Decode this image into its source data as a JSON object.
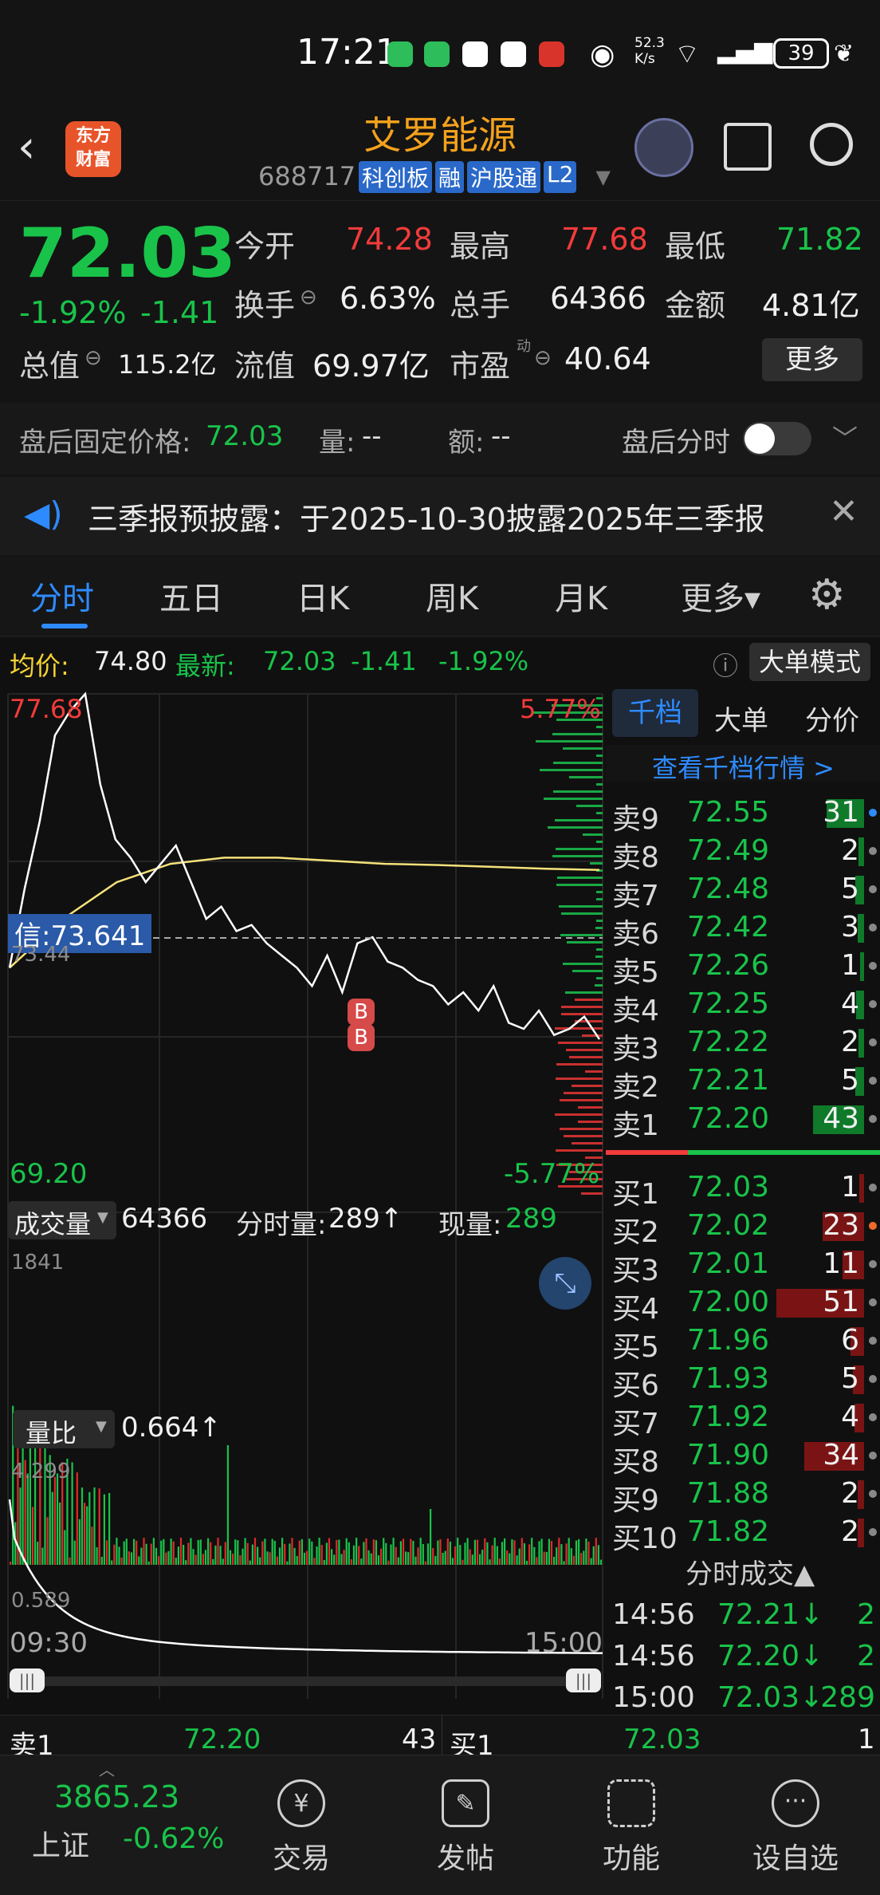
{
  "status_bar": {
    "time": "17:21",
    "net_speed": "52.3\nK/s",
    "battery": "39"
  },
  "header": {
    "logo_line1": "东方",
    "logo_line2": "财富",
    "title": "艾罗能源",
    "code": "688717",
    "tags": [
      "科创板",
      "融",
      "沪股通",
      "L2"
    ]
  },
  "quote": {
    "price": "72.03",
    "change_pct": "-1.92%",
    "change": "-1.41",
    "open_label": "今开",
    "open": "74.28",
    "high_label": "最高",
    "high": "77.68",
    "low_label": "最低",
    "low": "71.82",
    "turnover_label": "换手",
    "turnover": "6.63%",
    "volume_label": "总手",
    "volume": "64366",
    "amount_label": "金额",
    "amount": "4.81亿",
    "mcap_label": "总值",
    "mcap": "115.2亿",
    "float_label": "流值",
    "float": "69.97亿",
    "pe_label": "市盈",
    "pe_sup": "动",
    "pe": "40.64",
    "more_button": "更多"
  },
  "after_hours": {
    "price_label": "盘后固定价格:",
    "price": "72.03",
    "vol_label": "量:",
    "vol": "--",
    "amt_label": "额:",
    "amt": "--",
    "toggle_label": "盘后分时"
  },
  "notice": {
    "text": "三季报预披露：于2025-10-30披露2025年三季报"
  },
  "tabs": [
    {
      "label": "分时"
    },
    {
      "label": "五日"
    },
    {
      "label": "日K"
    },
    {
      "label": "周K"
    },
    {
      "label": "月K"
    },
    {
      "label": "更多▾"
    }
  ],
  "chart_info": {
    "avg_label": "均价:",
    "avg": "74.80",
    "latest_label": "最新:",
    "latest": "72.03",
    "chg": "-1.41",
    "pct": "-1.92%",
    "big_order_button": "大单模式"
  },
  "chart_labels": {
    "top_price": "77.68",
    "top_pct": "5.77%",
    "bottom_price": "69.20",
    "bottom_pct": "-5.77%",
    "cursor_label": "信:73.641",
    "ref_price": "73.44",
    "b_marker": "B"
  },
  "volume_bar": {
    "selector": "成交量",
    "total": "64366",
    "tick_label": "分时量:",
    "tick": "289↑",
    "now_label": "现量:",
    "now": "289",
    "max": "1841"
  },
  "ratio_bar": {
    "selector": "量比",
    "value": "0.664↑",
    "max": "4.299",
    "min": "0.589"
  },
  "time_axis": {
    "start": "09:30",
    "end": "15:00"
  },
  "chart_data": {
    "type": "line",
    "title": "",
    "series": [],
    "x_start": "09:30",
    "x_end": "15:00",
    "ylim": [
      69.2,
      77.68
    ],
    "price_path": [
      73.2,
      74.5,
      75.6,
      77.0,
      77.4,
      77.68,
      76.2,
      75.3,
      75.0,
      74.6,
      74.9,
      75.2,
      74.6,
      74.0,
      74.2,
      73.8,
      73.9,
      73.6,
      73.4,
      73.2,
      72.9,
      73.4,
      72.8,
      73.6,
      73.7,
      73.3,
      73.2,
      73.0,
      72.9,
      72.6,
      72.8,
      72.5,
      72.9,
      72.3,
      72.2,
      72.5,
      72.1,
      72.2,
      72.4,
      72.03
    ],
    "avg_path": [
      73.2,
      74.0,
      74.6,
      74.9,
      75.0,
      75.0,
      74.95,
      74.9,
      74.88,
      74.85,
      74.82,
      74.8
    ]
  },
  "order_book": {
    "tabs": [
      "千档",
      "大单",
      "分价"
    ],
    "view_link": "查看千档行情 >",
    "asks": [
      {
        "label": "卖9",
        "price": "72.55",
        "qty": "31"
      },
      {
        "label": "卖8",
        "price": "72.49",
        "qty": "2"
      },
      {
        "label": "卖7",
        "price": "72.48",
        "qty": "5"
      },
      {
        "label": "卖6",
        "price": "72.42",
        "qty": "3"
      },
      {
        "label": "卖5",
        "price": "72.26",
        "qty": "1"
      },
      {
        "label": "卖4",
        "price": "72.25",
        "qty": "4"
      },
      {
        "label": "卖3",
        "price": "72.22",
        "qty": "2"
      },
      {
        "label": "卖2",
        "price": "72.21",
        "qty": "5"
      },
      {
        "label": "卖1",
        "price": "72.20",
        "qty": "43"
      }
    ],
    "bids": [
      {
        "label": "买1",
        "price": "72.03",
        "qty": "1"
      },
      {
        "label": "买2",
        "price": "72.02",
        "qty": "23"
      },
      {
        "label": "买3",
        "price": "72.01",
        "qty": "11"
      },
      {
        "label": "买4",
        "price": "72.00",
        "qty": "51"
      },
      {
        "label": "买5",
        "price": "71.96",
        "qty": "6"
      },
      {
        "label": "买6",
        "price": "71.93",
        "qty": "5"
      },
      {
        "label": "买7",
        "price": "71.92",
        "qty": "4"
      },
      {
        "label": "买8",
        "price": "71.90",
        "qty": "34"
      },
      {
        "label": "买9",
        "price": "71.88",
        "qty": "2"
      },
      {
        "label": "买10",
        "price": "71.82",
        "qty": "2"
      }
    ],
    "ticks_header": "分时成交▲",
    "ticks": [
      {
        "time": "14:56",
        "price": "72.21↓",
        "qty": "2"
      },
      {
        "time": "14:56",
        "price": "72.20↓",
        "qty": "2"
      },
      {
        "time": "15:00",
        "price": "72.03↓",
        "qty": "289"
      }
    ]
  },
  "bottom_quote": {
    "ask_label": "卖1",
    "ask_price": "72.20",
    "ask_qty": "43",
    "bid_label": "买1",
    "bid_price": "72.03",
    "bid_qty": "1"
  },
  "bottom_nav": {
    "index_value": "3865.23",
    "index_name": "上证",
    "index_pct": "-0.62%",
    "trade": "交易",
    "post": "发帖",
    "func": "功能",
    "watch": "设自选"
  },
  "colors": {
    "up": "#f23b3b",
    "down": "#19c34a",
    "avg_line": "#f5e27a",
    "accent": "#2e8bff"
  }
}
